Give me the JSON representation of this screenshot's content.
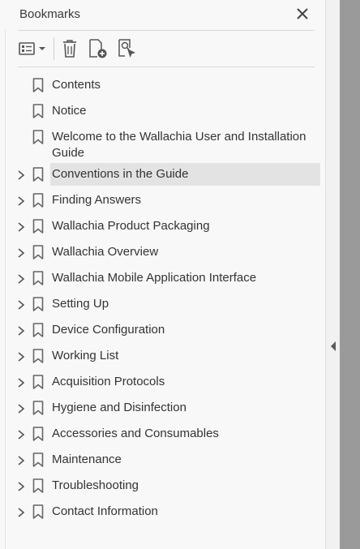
{
  "header": {
    "title": "Bookmarks"
  },
  "toolbar": {
    "options_icon": "list-options-icon",
    "delete_icon": "trash-icon",
    "new_bookmark_icon": "new-bookmark-icon",
    "find_bookmark_icon": "find-current-bookmark-icon"
  },
  "bookmarks": [
    {
      "label": "Contents",
      "expandable": false,
      "selected": false
    },
    {
      "label": "Notice",
      "expandable": false,
      "selected": false
    },
    {
      "label": "Welcome to the Wallachia User and Installation Guide",
      "expandable": false,
      "selected": false
    },
    {
      "label": "Conventions in the Guide",
      "expandable": true,
      "selected": true
    },
    {
      "label": "Finding Answers",
      "expandable": true,
      "selected": false
    },
    {
      "label": "Wallachia Product Packaging",
      "expandable": true,
      "selected": false
    },
    {
      "label": "Wallachia Overview",
      "expandable": true,
      "selected": false
    },
    {
      "label": "Wallachia Mobile Application Interface",
      "expandable": true,
      "selected": false
    },
    {
      "label": "Setting Up",
      "expandable": true,
      "selected": false
    },
    {
      "label": "Device Configuration",
      "expandable": true,
      "selected": false
    },
    {
      "label": "Working List",
      "expandable": true,
      "selected": false
    },
    {
      "label": "Acquisition Protocols",
      "expandable": true,
      "selected": false
    },
    {
      "label": "Hygiene and Disinfection",
      "expandable": true,
      "selected": false
    },
    {
      "label": "Accessories and Consumables",
      "expandable": true,
      "selected": false
    },
    {
      "label": "Maintenance",
      "expandable": true,
      "selected": false
    },
    {
      "label": "Troubleshooting",
      "expandable": true,
      "selected": false
    },
    {
      "label": "Contact Information",
      "expandable": true,
      "selected": false
    }
  ],
  "colors": {
    "panel_bg": "#f8f8f8",
    "selected_bg": "#e3e3e3",
    "text": "#333333",
    "icon": "#5a5a5a"
  }
}
